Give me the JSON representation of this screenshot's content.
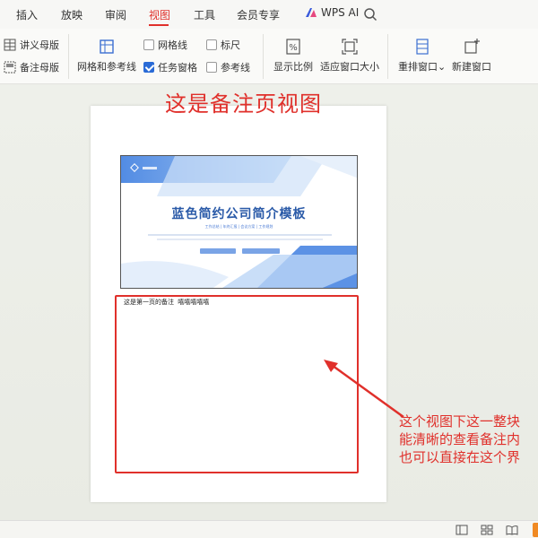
{
  "menubar": {
    "items": [
      "插入",
      "放映",
      "审阅",
      "视图",
      "工具",
      "会员专享"
    ],
    "active": "视图",
    "ai_label": "WPS AI"
  },
  "ribbon": {
    "handout_master": "讲义母版",
    "notes_master": "备注母版",
    "grid_and_guides": "网格和参考线",
    "gridlines": "网格线",
    "ruler": "标尺",
    "task_pane": "任务窗格",
    "guides": "参考线",
    "zoom": "显示比例",
    "fit_window": "适应窗口大小",
    "arrange_window": "重排窗口",
    "new_window": "新建窗口",
    "checks": {
      "gridlines": false,
      "ruler": false,
      "task_pane": true,
      "guides": false
    }
  },
  "canvas": {
    "view_title": "这是备注页视图",
    "slide": {
      "title": "蓝色简约公司简介模板",
      "subtitle": "工作总结 | 年终汇报 | 会议方案 | 工作规划"
    },
    "notes_text": "这是第一页的备注  嘻嘻嘻嘻嘻",
    "annotation": [
      "这个视图下这一整块",
      "能清晰的查看备注内",
      "也可以直接在这个界"
    ]
  },
  "colors": {
    "accent_red": "#e0302b",
    "brand_blue": "#2a5aa8",
    "checkbox_blue": "#2a6bd6"
  }
}
